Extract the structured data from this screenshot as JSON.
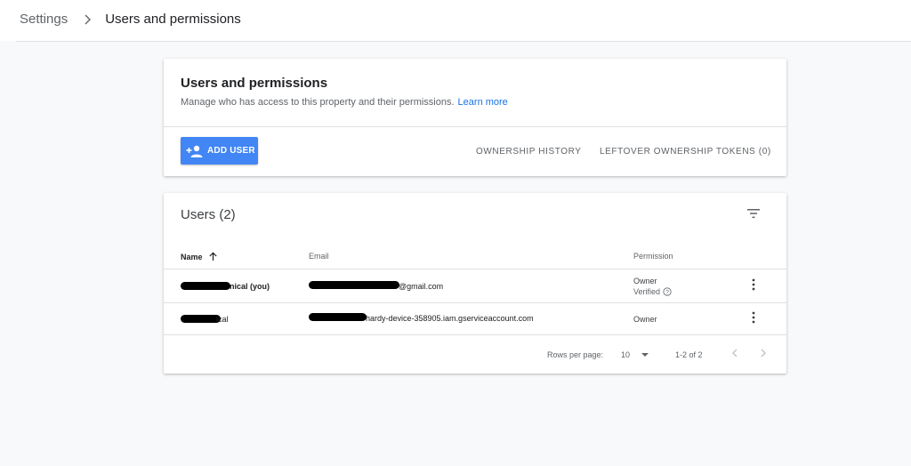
{
  "breadcrumb": {
    "parent": "Settings",
    "current": "Users and permissions"
  },
  "header_card": {
    "title": "Users and permissions",
    "subtitle": "Manage who has access to this property and their permissions.",
    "learn_more": "Learn more",
    "add_user": "ADD USER",
    "ownership_history": "OWNERSHIP HISTORY",
    "leftover_tokens": "LEFTOVER OWNERSHIP TOKENS (0)"
  },
  "users_card": {
    "title": "Users (2)",
    "columns": {
      "name": "Name",
      "email": "Email",
      "permission": "Permission"
    },
    "rows": [
      {
        "name": "nical (you)",
        "email": "@gmail.com",
        "permission": "Owner",
        "status": "Verified"
      },
      {
        "name": "ical",
        "email": "hardy-device-358905.iam.gserviceaccount.com",
        "permission": "Owner"
      }
    ],
    "pagination": {
      "rows_per_page_label": "Rows per page:",
      "rows_per_page": "10",
      "range": "1-2 of 2"
    }
  },
  "colors": {
    "accent": "#4285f4",
    "link": "#1a73e8",
    "background": "#f8f9fa"
  },
  "icons": [
    "chevron-right-icon",
    "add-person-icon",
    "filter-icon",
    "sort-arrow-up-icon",
    "help-circle-icon",
    "more-vert-icon",
    "dropdown-arrow-icon",
    "chevron-left-icon"
  ]
}
